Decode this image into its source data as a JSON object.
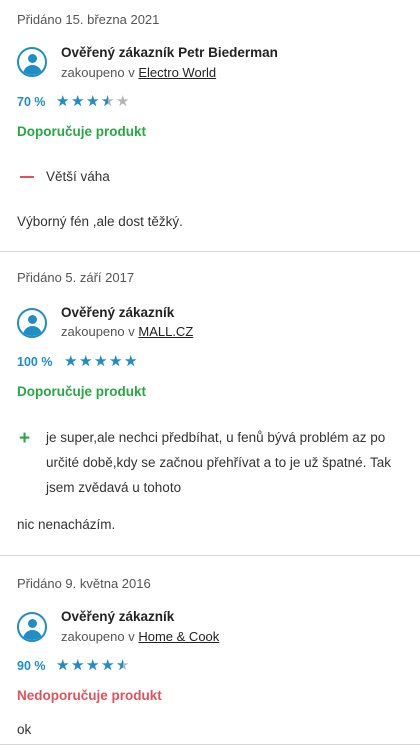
{
  "reviews": [
    {
      "date": "Přidáno 15. března 2021",
      "author": "Ověřený zákazník Petr Biederman",
      "bought_prefix": "zakoupeno v",
      "shop": "Electro World",
      "rating_percent": "70 %",
      "rating_stars": 3.5,
      "recommendation": "Doporučuje produkt",
      "recommends": true,
      "cons": [
        "Větší váha"
      ],
      "pros": [],
      "text": "Výborný fén ,ale dost těžký."
    },
    {
      "date": "Přidáno 5. září 2017",
      "author": "Ověřený zákazník",
      "bought_prefix": "zakoupeno v",
      "shop": "MALL.CZ",
      "rating_percent": "100 %",
      "rating_stars": 5,
      "recommendation": "Doporučuje produkt",
      "recommends": true,
      "cons": [],
      "pros": [
        "je super,ale nechci předbíhat, u fenů bývá problém az po určité době,kdy se začnou přehřívat a to je už špatné. Tak jsem zvědavá u tohoto"
      ],
      "text": "nic nenacházím."
    },
    {
      "date": "Přidáno 9. května 2016",
      "author": "Ověřený zákazník",
      "bought_prefix": "zakoupeno v",
      "shop": "Home & Cook",
      "rating_percent": "90 %",
      "rating_stars": 4.5,
      "recommendation": "Nedoporučuje produkt",
      "recommends": false,
      "cons": [],
      "pros": [],
      "text": "ok"
    }
  ],
  "colors": {
    "accent": "#1e8dc8",
    "positive": "#28a745",
    "negative": "#e0535d",
    "star_empty": "#b5b5b5"
  },
  "icons": {
    "avatar": "user-avatar-icon",
    "star": "star-icon",
    "minus": "minus-icon",
    "plus": "plus-icon"
  }
}
